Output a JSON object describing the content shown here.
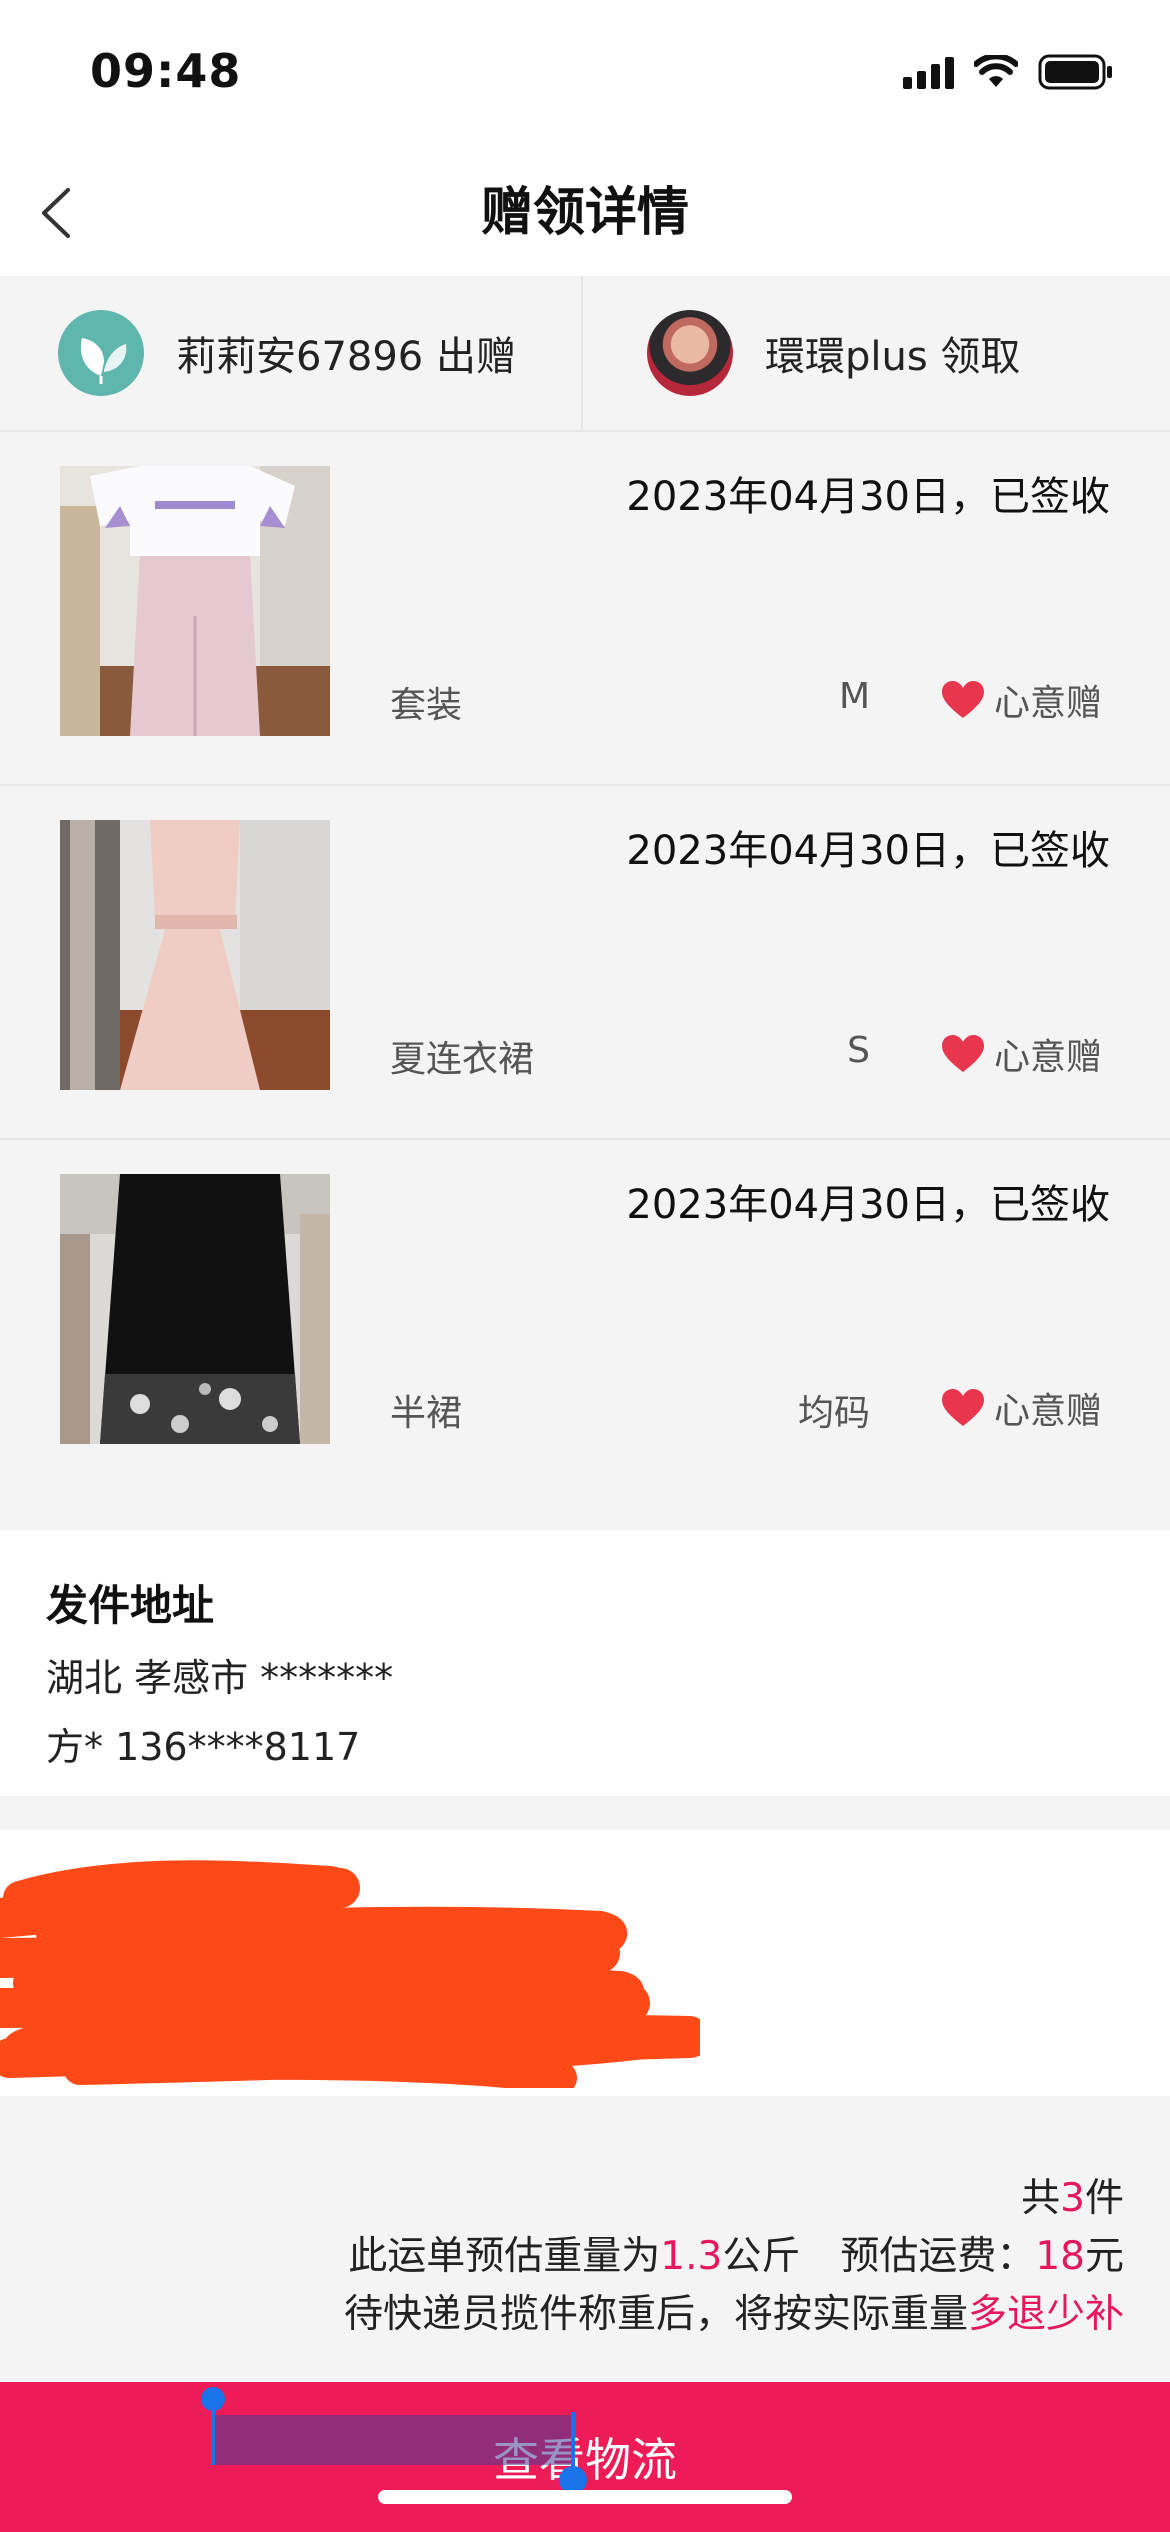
{
  "status_bar": {
    "time": "09:48"
  },
  "nav": {
    "title": "赠领详情"
  },
  "giver": {
    "text": "莉莉安67896 出赠"
  },
  "receiver": {
    "text": "環環plus 领取"
  },
  "items": [
    {
      "date": "2023年04月30日，已签收",
      "name": "套装",
      "size": "M",
      "tag": "心意赠"
    },
    {
      "date": "2023年04月30日，已签收",
      "name": "夏连衣裙",
      "size": "S",
      "tag": "心意赠"
    },
    {
      "date": "2023年04月30日，已签收",
      "name": "半裙",
      "size": "均码",
      "tag": "心意赠"
    }
  ],
  "sender_address": {
    "title": "发件地址",
    "region": "湖北 孝感市 *******",
    "contact": "方* 136****8117"
  },
  "summary": {
    "count_prefix": "共",
    "count": "3",
    "count_suffix": "件",
    "weight_prefix": "此运单预估重量为",
    "weight": "1.3",
    "weight_unit": "公斤",
    "fee_label": "预估运费：",
    "fee": "18",
    "fee_unit": "元",
    "note_prefix": "待快递员揽件称重后，将按实际重量",
    "note_highlight": "多退少补"
  },
  "bottom_button": {
    "label": "查看物流"
  },
  "colors": {
    "accent": "#ed1c57",
    "highlight_text": "#e5175d",
    "heart": "#e8364f"
  }
}
